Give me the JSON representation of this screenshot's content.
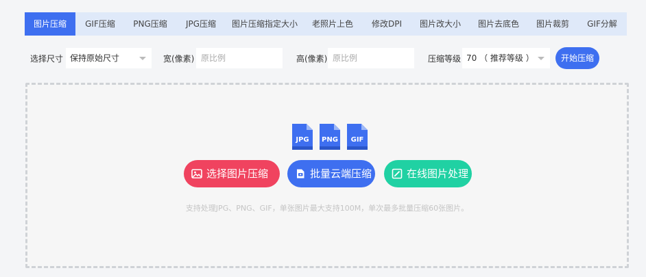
{
  "tabs": [
    {
      "label": "图片压缩",
      "active": true
    },
    {
      "label": "GIF压缩"
    },
    {
      "label": "PNG压缩"
    },
    {
      "label": "JPG压缩"
    },
    {
      "label": "图片压缩指定大小"
    },
    {
      "label": "老照片上色"
    },
    {
      "label": "修改DPI"
    },
    {
      "label": "图片改大小"
    },
    {
      "label": "图片去底色"
    },
    {
      "label": "图片裁剪"
    },
    {
      "label": "GIF分解"
    }
  ],
  "toolbar": {
    "size_label": "选择尺寸",
    "size_value": "保持原始尺寸",
    "width_label": "宽(像素)",
    "width_placeholder": "原比例",
    "height_label": "高(像素)",
    "height_placeholder": "原比例",
    "level_label": "压缩等级",
    "level_value": "70 （ 推荐等级 ）",
    "start_label": "开始压缩"
  },
  "dropzone": {
    "file_types": [
      "JPG",
      "PNG",
      "GIF"
    ],
    "select_label": "选择图片压缩",
    "batch_label": "批量云端压缩",
    "online_label": "在线图片处理",
    "hint": "支持处理JPG、PNG、GIF，单张图片最大支持100M，单次最多批量压缩60张图片。"
  },
  "colors": {
    "primary": "#3e6ff0",
    "tab_bg": "#dfe9f9",
    "red": "#f0435f",
    "green": "#20d1a3"
  }
}
